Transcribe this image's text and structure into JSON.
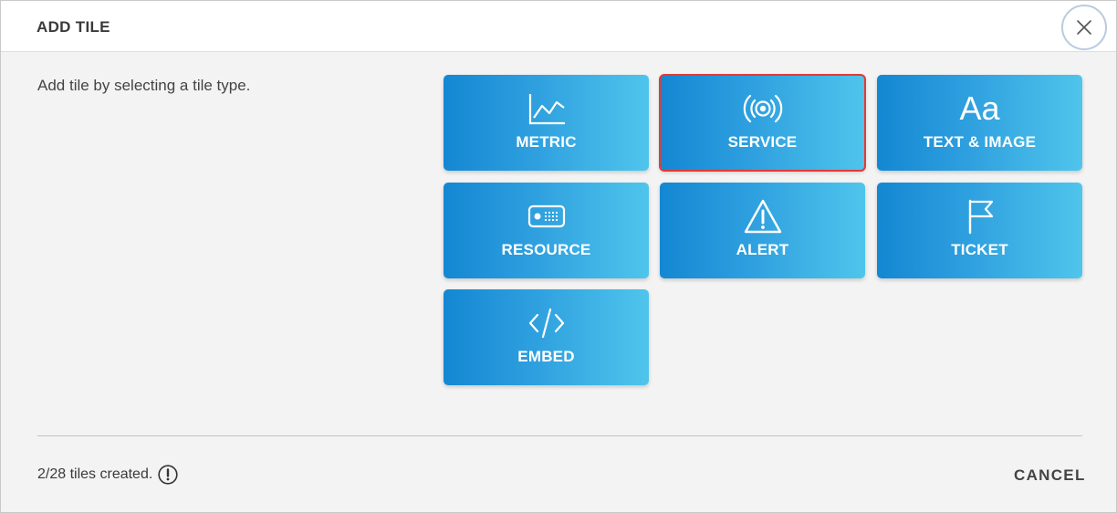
{
  "header": {
    "title": "ADD TILE",
    "close_icon": "close-icon"
  },
  "instruction": "Add tile by selecting a tile type.",
  "tiles": [
    {
      "label": "METRIC",
      "icon": "line-chart-icon"
    },
    {
      "label": "SERVICE",
      "icon": "broadcast-icon",
      "selected": true
    },
    {
      "label": "TEXT & IMAGE",
      "icon": "text-aa-icon",
      "glyph": "Aa"
    },
    {
      "label": "RESOURCE",
      "icon": "server-device-icon"
    },
    {
      "label": "ALERT",
      "icon": "warning-triangle-icon"
    },
    {
      "label": "TICKET",
      "icon": "flag-icon"
    },
    {
      "label": "EMBED",
      "icon": "code-icon"
    }
  ],
  "footer": {
    "status": "2/28 tiles created.",
    "info_icon": "info-icon",
    "cancel_label": "CANCEL"
  },
  "colors": {
    "tile_gradient_start": "#1487d3",
    "tile_gradient_end": "#4fc5ec",
    "selected_border": "#e53935",
    "header_bg": "#ffffff",
    "body_bg": "#f3f3f3"
  }
}
